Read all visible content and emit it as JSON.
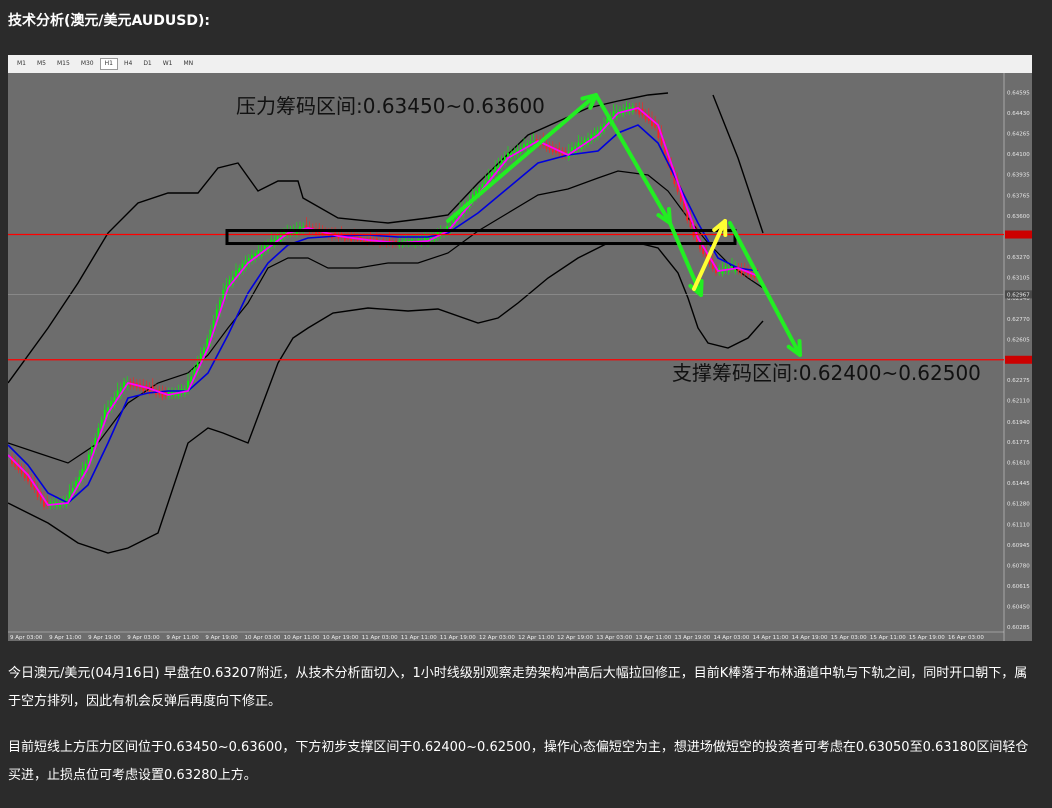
{
  "heading": "技术分析(澳元/美元AUDUSD):",
  "timeframes": [
    "M1",
    "M5",
    "M15",
    "M30",
    "H1",
    "H4",
    "D1",
    "W1",
    "MN"
  ],
  "active_timeframe": "H1",
  "paragraphs": [
    "今日澳元/美元(04月16日) 早盘在0.63207附近，从技术分析面切入，1小时线级别观察走势架构冲高后大幅拉回修正，目前K棒落于布林通道中轨与下轨之间，同时开口朝下，属于空方排列，因此有机会反弹后再度向下修正。",
    "目前短线上方压力区间位于0.63450~0.63600，下方初步支撑区间于0.62400~0.62500，操作心态偏短空为主，想进场做短空的投资者可考虑在0.63050至0.63180区间轻仓买进，止损点位可考虑设置0.63280上方。"
  ],
  "chart_data": {
    "type": "line",
    "symbol": "AUDUSD",
    "timeframe": "H1",
    "price_ticks": [
      "0.64595",
      "0.64430",
      "0.64265",
      "0.64100",
      "0.63935",
      "0.63765",
      "0.63600",
      "0.63435",
      "0.63270",
      "0.63105",
      "0.62940",
      "0.62770",
      "0.62605",
      "0.62440",
      "0.62275",
      "0.62110",
      "0.61940",
      "0.61775",
      "0.61610",
      "0.61445",
      "0.61280",
      "0.61110",
      "0.60945",
      "0.60780",
      "0.60615",
      "0.60450",
      "0.60285"
    ],
    "ylim": [
      0.60285,
      0.6468
    ],
    "time_ticks": [
      "9 Apr 03:00",
      "9 Apr 11:00",
      "9 Apr 19:00",
      "9 Apr 03:00",
      "9 Apr 11:00",
      "9 Apr 19:00",
      "10 Apr 03:00",
      "10 Apr 11:00",
      "10 Apr 19:00",
      "11 Apr 03:00",
      "11 Apr 11:00",
      "11 Apr 19:00",
      "12 Apr 03:00",
      "12 Apr 11:00",
      "12 Apr 19:00",
      "13 Apr 03:00",
      "13 Apr 11:00",
      "13 Apr 19:00",
      "14 Apr 03:00",
      "14 Apr 11:00",
      "14 Apr 19:00",
      "15 Apr 03:00",
      "15 Apr 11:00",
      "15 Apr 19:00",
      "16 Apr 03:00"
    ],
    "current_price_tag": "0.62967",
    "resistance": {
      "label": "压力筹码区间:0.63450~0.63600",
      "low": 0.6345,
      "high": 0.636,
      "line": 0.6345
    },
    "support": {
      "label": "支撑筹码区间:0.62400~0.62500",
      "low": 0.624,
      "high": 0.625,
      "line": 0.6244
    },
    "colors": {
      "background": "#6d6d6d",
      "upper_band": "#000000",
      "lower_band": "#000000",
      "middle_band": "#000000",
      "fast_ma": "#ff00ff",
      "slow_ma": "#0000dd",
      "bull_candle": "#00ff00",
      "bear_candle": "#ff2020",
      "zone_line": "#ff0000",
      "arrow_main": "#22ee22",
      "arrow_bounce": "#ffff33"
    }
  }
}
